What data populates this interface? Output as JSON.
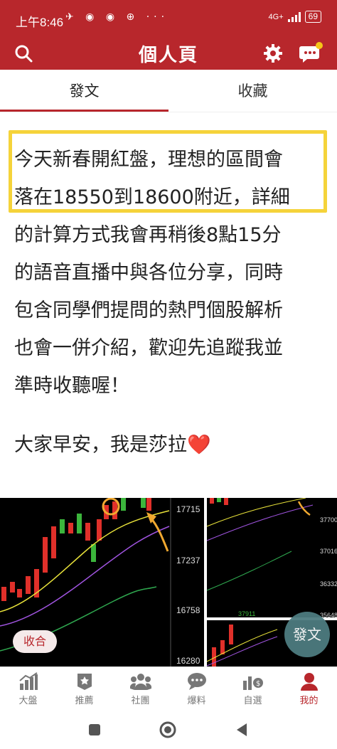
{
  "status": {
    "time": "上午8:46",
    "left_icons": "✈ ◉ ◉ ⊕ ···",
    "network": "4G+",
    "battery": "69"
  },
  "app_bar": {
    "title": "個人頁"
  },
  "tabs": [
    {
      "label": "發文",
      "active": true
    },
    {
      "label": "收藏",
      "active": false
    }
  ],
  "post": {
    "line1": "今天新春開紅盤，理想的區間會",
    "line2": "落在18550到18600附近，詳細",
    "line3": "的計算方式我會再稍後8點15分",
    "line4": "的語音直播中與各位分享，同時",
    "line5": "包含同學們提問的熱門個股解析",
    "line6": "也會一併介紹，歡迎先追蹤我並",
    "line7": "準時收聽喔！",
    "greeting": "大家早安，我是莎拉",
    "heart": "❤️"
  },
  "chart": {
    "left_ticks": [
      "17715",
      "17237",
      "16758",
      "16280"
    ],
    "right_ticks": [
      "37700",
      "37016",
      "36332",
      "35648"
    ],
    "mini_label": "37911",
    "badge": "收合",
    "fab_label": "發文"
  },
  "bottom_nav": [
    {
      "label": "大盤",
      "icon": "chart-icon",
      "active": false
    },
    {
      "label": "推薦",
      "icon": "badge-icon",
      "active": false
    },
    {
      "label": "社團",
      "icon": "group-icon",
      "active": false
    },
    {
      "label": "爆料",
      "icon": "chat-icon",
      "active": false
    },
    {
      "label": "自選",
      "icon": "stocks-icon",
      "active": false
    },
    {
      "label": "我的",
      "icon": "person-icon",
      "active": true
    }
  ],
  "colors": {
    "brand": "#b8272c",
    "highlight": "#f5d33a",
    "fab": "#4d7c80"
  }
}
